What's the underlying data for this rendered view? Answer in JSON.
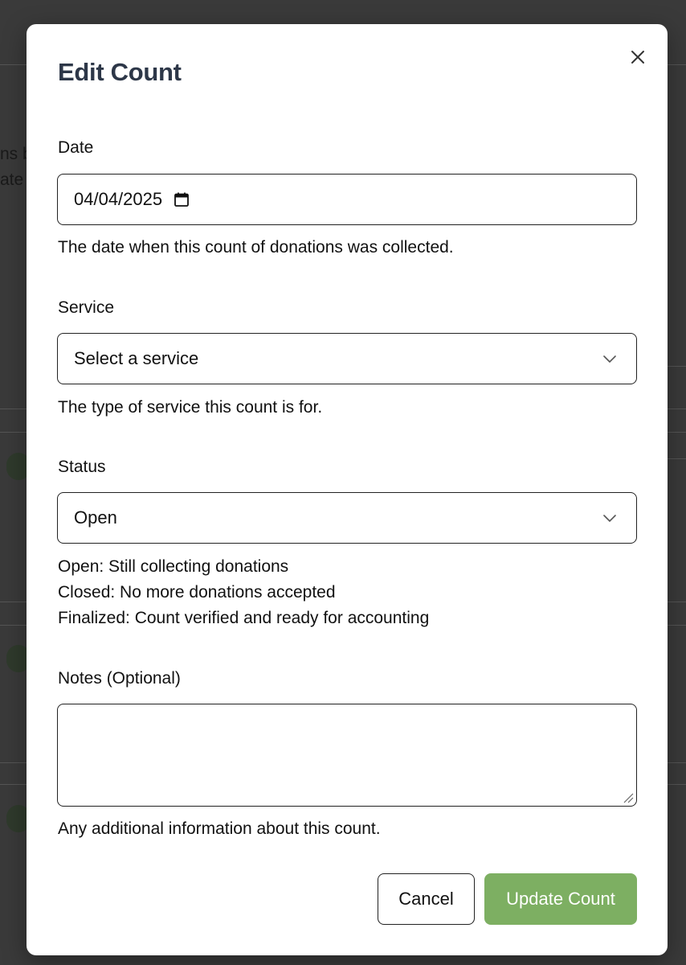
{
  "modal": {
    "title": "Edit Count",
    "close_icon": "close-icon"
  },
  "date_field": {
    "label": "Date",
    "value": "04/04/2025",
    "icon": "calendar-icon",
    "help": "The date when this count of donations was collected."
  },
  "service_field": {
    "label": "Service",
    "value": "Select a service",
    "icon": "chevron-down-icon",
    "help": "The type of service this count is for."
  },
  "status_field": {
    "label": "Status",
    "value": "Open",
    "icon": "chevron-down-icon",
    "help_lines": [
      "Open: Still collecting donations",
      "Closed: No more donations accepted",
      "Finalized: Count verified and ready for accounting"
    ]
  },
  "notes_field": {
    "label": "Notes (Optional)",
    "value": "",
    "help": "Any additional information about this count."
  },
  "actions": {
    "cancel_label": "Cancel",
    "submit_label": "Update Count"
  },
  "background": {
    "text_fragments": [
      "ns b",
      "ate"
    ]
  },
  "colors": {
    "submit_button": "#7daf62",
    "title": "#2d3748",
    "backdrop": "#333333"
  }
}
